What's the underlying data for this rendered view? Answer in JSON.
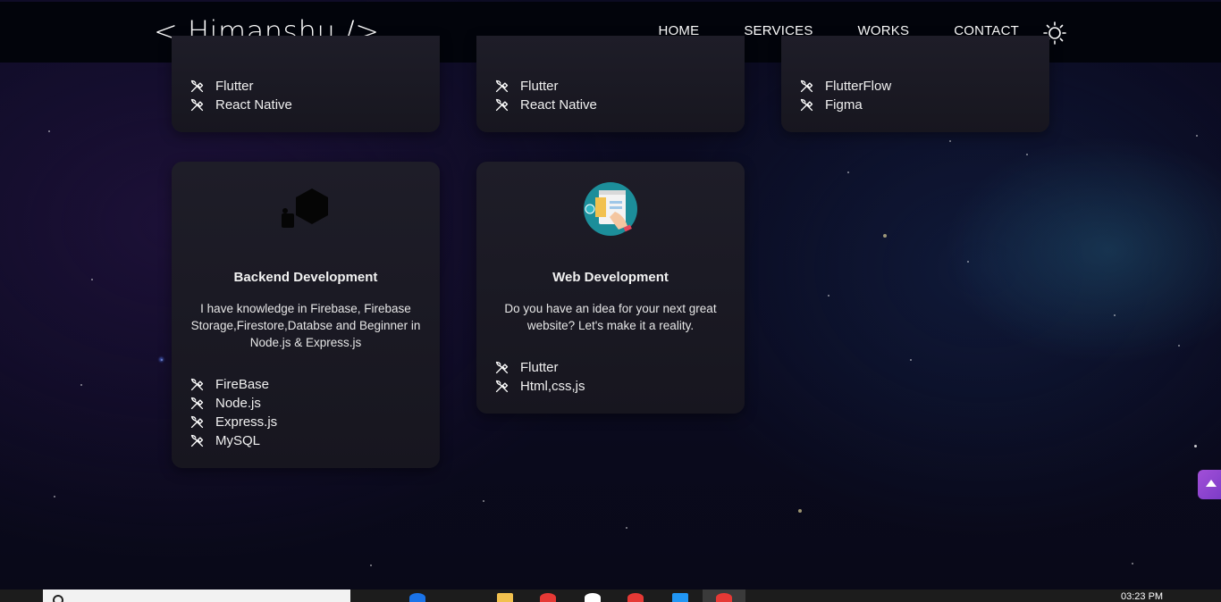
{
  "navbar": {
    "logo": "< Himanshu />",
    "links": [
      "HOME",
      "SERVICES",
      "WORKS",
      "CONTACT"
    ],
    "theme_icon": "sun-icon"
  },
  "cards": {
    "top_left": {
      "tools": [
        "Flutter",
        "React Native"
      ]
    },
    "top_middle": {
      "tools": [
        "Flutter",
        "React Native"
      ]
    },
    "top_right": {
      "tools": [
        "FlutterFlow",
        "Figma"
      ]
    },
    "backend": {
      "icon": "hexagon-icon",
      "title": "Backend Development",
      "description": "I have knowledge in Firebase, Firebase Storage,Firestore,Databse and Beginner in Node.js & Express.js",
      "tools": [
        "FireBase",
        "Node.js",
        "Express.js",
        "MySQL"
      ]
    },
    "web": {
      "icon": "web-design-icon",
      "title": "Web Development",
      "description": "Do you have an idea for your next great website? Let's make it a reality.",
      "tools": [
        "Flutter",
        "Html,css,js"
      ]
    }
  },
  "tool_icon": "tools-icon",
  "scroll_top_icon": "arrow-up-icon",
  "taskbar": {
    "time": "03:23 PM"
  },
  "colors": {
    "accent": "#a24fd8",
    "card_bg": "#1e1d28",
    "navbar_bg": "#02040b"
  }
}
